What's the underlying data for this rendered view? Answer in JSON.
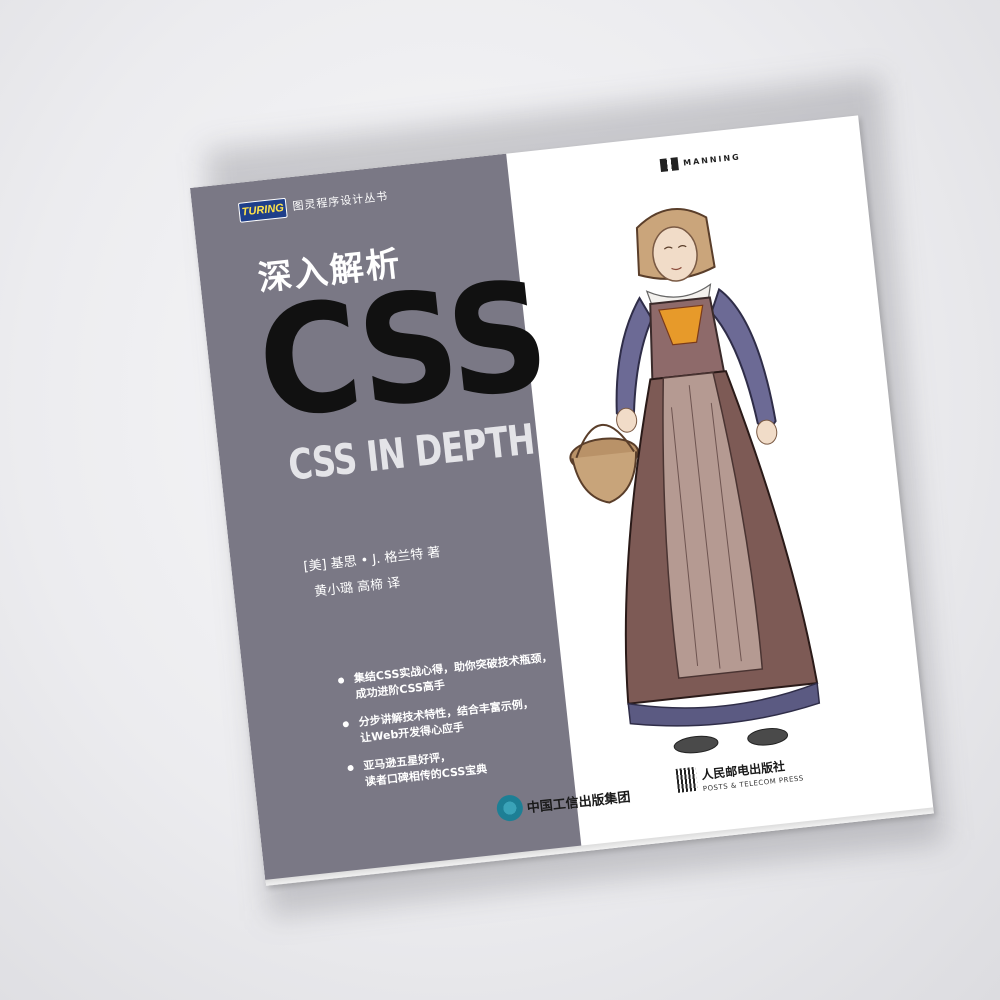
{
  "cover": {
    "series_logo": "TURING",
    "series_name": "图灵程序设计丛书",
    "title_cn": "深入解析",
    "title_main": "CSS",
    "title_en": "CSS IN DEPTH",
    "author": "[美] 基思 • J. 格兰特 著",
    "translators": "黄小璐 高楴 译",
    "bullets": [
      [
        "集结CSS实战心得，助你突破技术瓶颈，",
        "成功进阶CSS高手"
      ],
      [
        "分步讲解技术特性，结合丰富示例，",
        "让Web开发得心应手"
      ],
      [
        "亚马逊五星好评，",
        "读者口碑相传的CSS宝典"
      ]
    ],
    "publisher_group": "中国工信出版集团",
    "publisher_name": "人民邮电出版社",
    "publisher_name_en": "POSTS & TELECOM PRESS",
    "manning": "MANNING"
  },
  "colors": {
    "panel": "#7a7885",
    "title_main": "#111111",
    "background": "#ececef"
  }
}
